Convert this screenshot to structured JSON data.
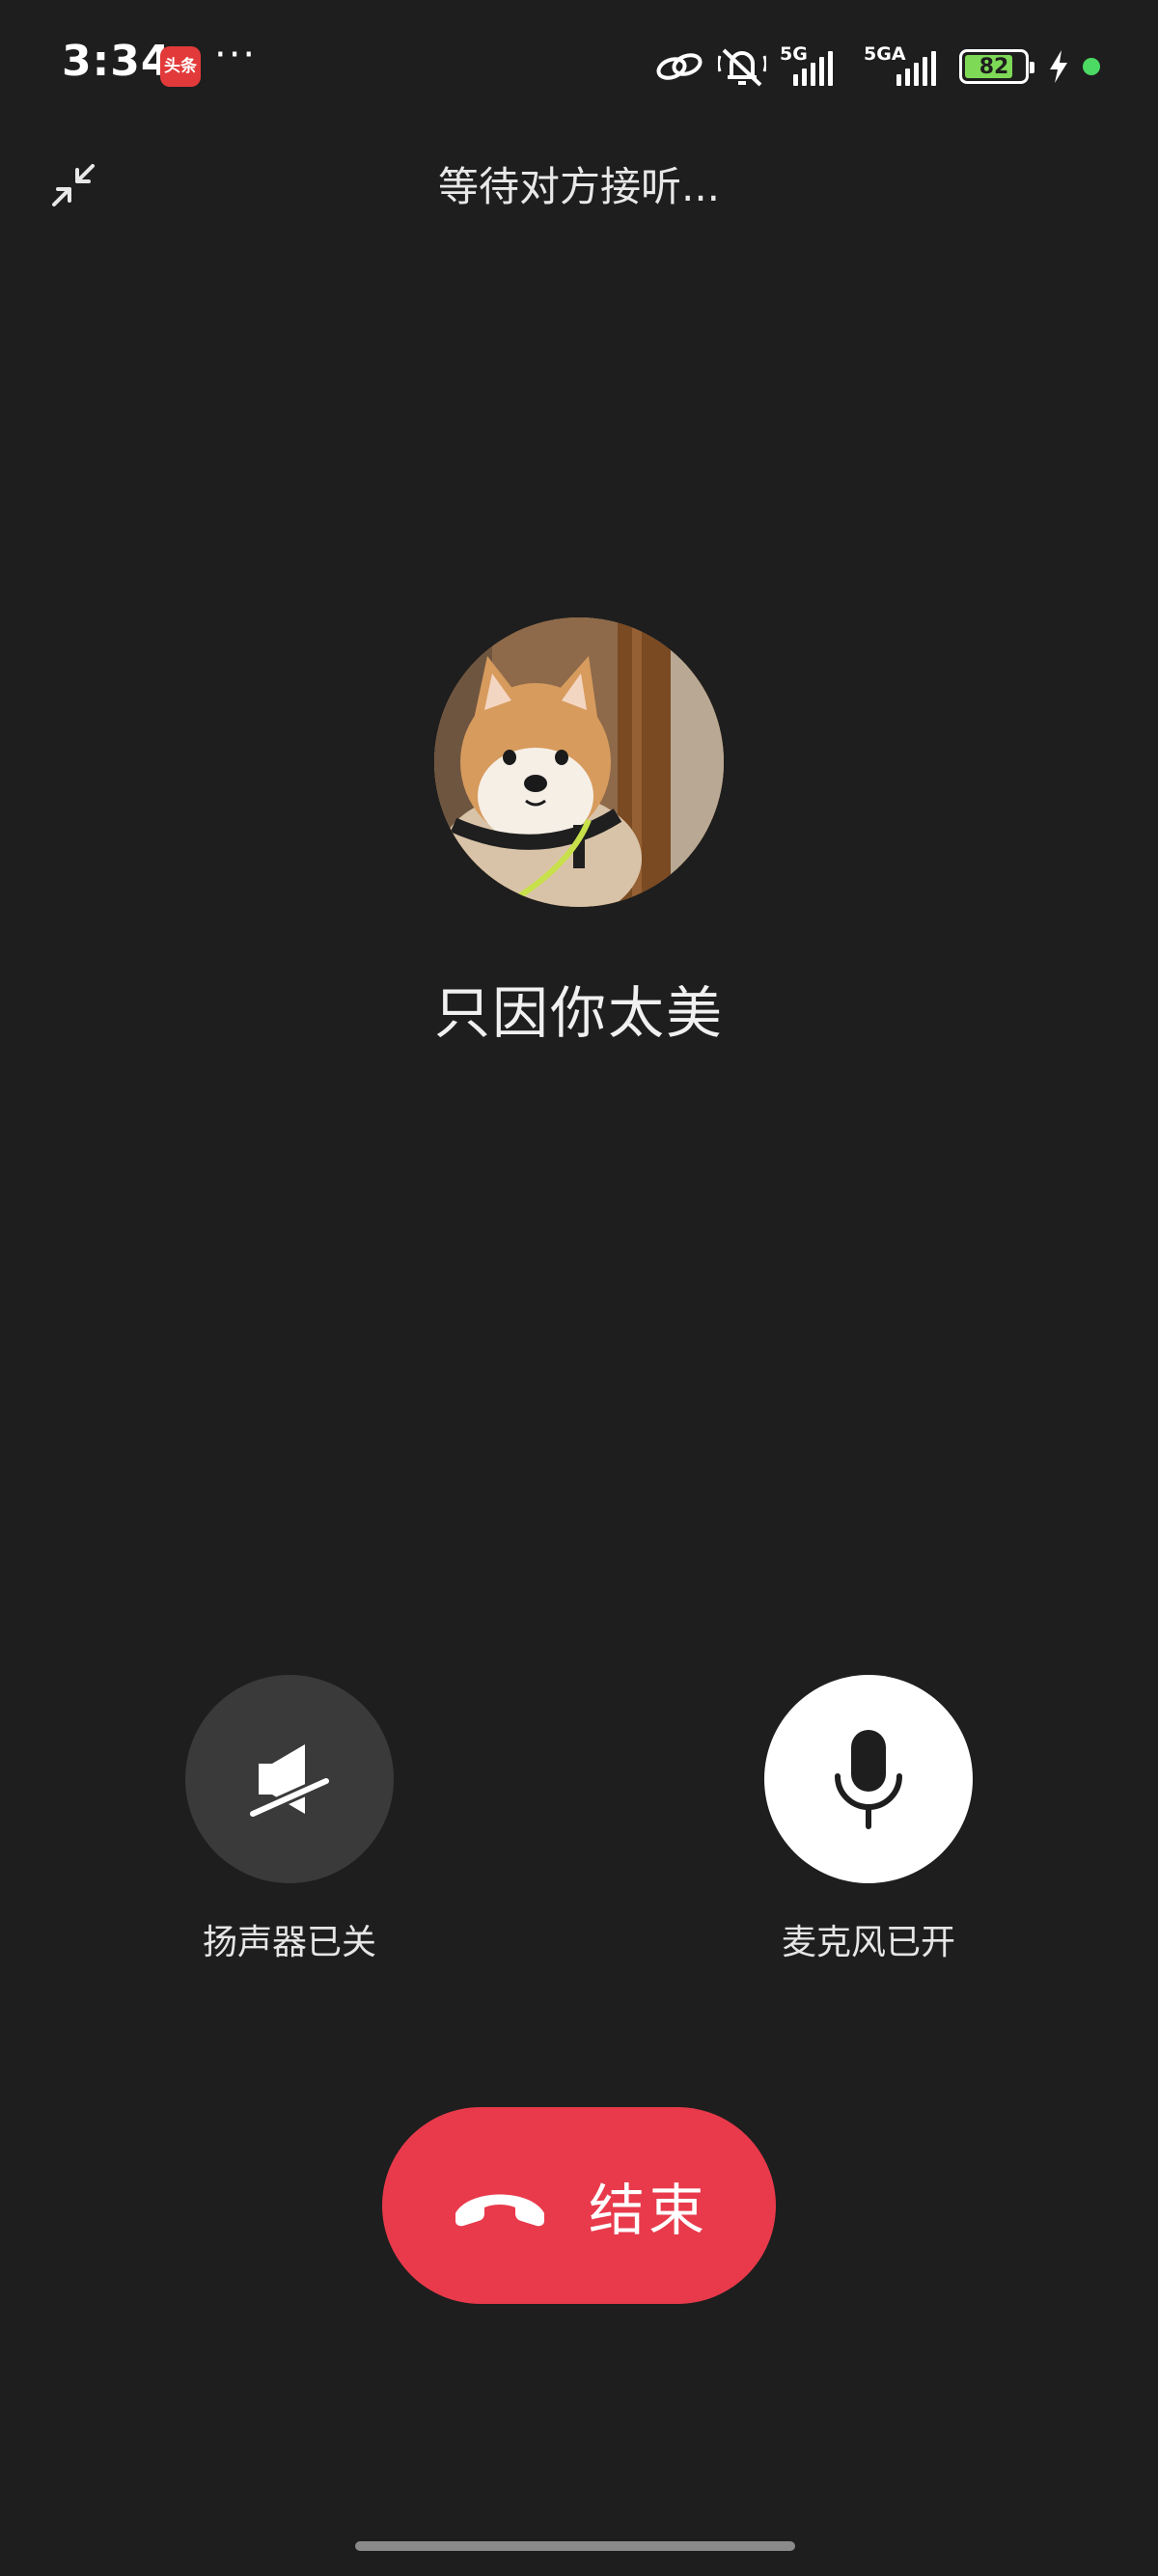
{
  "status_bar": {
    "time": "3:34",
    "app_badge": "头条",
    "more": "···",
    "network_1": "5G",
    "network_2": "5GA",
    "battery": "82",
    "battery_level": 0.82
  },
  "header": {
    "call_status": "等待对方接听..."
  },
  "contact": {
    "name": "只因你太美"
  },
  "controls": {
    "speaker_label": "扬声器已关",
    "mic_label": "麦克风已开",
    "end_label": "结束"
  },
  "colors": {
    "background": "#1e1e1e",
    "end_call": "#e83a4b",
    "speaker_bg": "#3a3a3a",
    "mic_bg": "#ffffff"
  },
  "icons": {
    "minimize": "minimize-icon",
    "speaker": "speaker-off-icon",
    "mic": "microphone-icon",
    "end": "hang-up-icon"
  }
}
